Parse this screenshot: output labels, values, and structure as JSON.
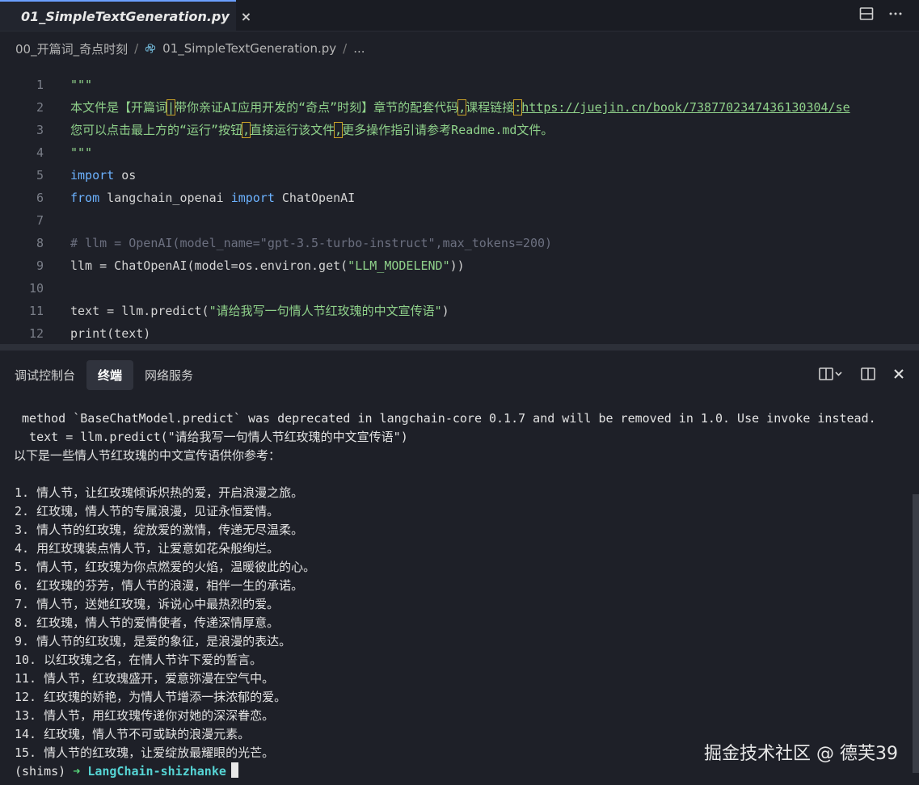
{
  "tab": {
    "label": "01_SimpleTextGeneration.py",
    "close": "×"
  },
  "breadcrumb": {
    "folder": "00_开篇词_奇点时刻",
    "file": "01_SimpleTextGeneration.py",
    "more": "..."
  },
  "editor": {
    "lines": [
      {
        "n": "1"
      },
      {
        "n": "2"
      },
      {
        "n": "3"
      },
      {
        "n": "4"
      },
      {
        "n": "5"
      },
      {
        "n": "6"
      },
      {
        "n": "7"
      },
      {
        "n": "8"
      },
      {
        "n": "9"
      },
      {
        "n": "10"
      },
      {
        "n": "11"
      },
      {
        "n": "12"
      }
    ],
    "code": {
      "l1": "\"\"\"",
      "l2a": "本文件是【开篇词",
      "l2b": "|",
      "l2c": "带你亲证AI应用开发的“奇点”时刻】章节的配套代码",
      "l2d": ",",
      "l2e": "课程链接",
      "l2f": ":",
      "l2g": "https://juejin.cn/book/7387702347436130304/se",
      "l3a": "您可以点击最上方的“运行”按钮",
      "l3b": ",",
      "l3c": "直接运行该文件",
      "l3d": ",",
      "l3e": "更多操作指引请参考Readme.md文件。",
      "l4": "\"\"\"",
      "l5kw": "import",
      "l5": " os",
      "l6kw1": "from",
      "l6mod": " langchain_openai ",
      "l6kw2": "import",
      "l6": " ChatOpenAI",
      "l8": "# llm = OpenAI(model_name=\"gpt-3.5-turbo-instruct\",max_tokens=200)",
      "l9a": "llm = ChatOpenAI(model=os.environ.get(",
      "l9s": "\"LLM_MODELEND\"",
      "l9b": "))",
      "l11a": "text = llm.predict(",
      "l11s": "\"请给我写一句情人节红玫瑰的中文宣传语\"",
      "l11b": ")",
      "l12": "print(text)"
    }
  },
  "panel": {
    "tabs": [
      "调试控制台",
      "终端",
      "网络服务"
    ],
    "active": "终端"
  },
  "terminal": {
    "lines": [
      " method `BaseChatModel.predict` was deprecated in langchain-core 0.1.7 and will be removed in 1.0. Use invoke instead.",
      "  text = llm.predict(\"请给我写一句情人节红玫瑰的中文宣传语\")",
      "以下是一些情人节红玫瑰的中文宣传语供你参考：",
      "",
      "1. 情人节，让红玫瑰倾诉炽热的爱，开启浪漫之旅。",
      "2. 红玫瑰，情人节的专属浪漫，见证永恒爱情。",
      "3. 情人节的红玫瑰，绽放爱的激情，传递无尽温柔。",
      "4. 用红玫瑰装点情人节，让爱意如花朵般绚烂。",
      "5. 情人节，红玫瑰为你点燃爱的火焰，温暖彼此的心。",
      "6. 红玫瑰的芬芳，情人节的浪漫，相伴一生的承诺。",
      "7. 情人节，送她红玫瑰，诉说心中最热烈的爱。",
      "8. 红玫瑰，情人节的爱情使者，传递深情厚意。",
      "9. 情人节的红玫瑰，是爱的象征，是浪漫的表达。",
      "10. 以红玫瑰之名，在情人节许下爱的誓言。",
      "11. 情人节，红玫瑰盛开，爱意弥漫在空气中。",
      "12. 红玫瑰的娇艳，为情人节增添一抹浓郁的爱。",
      "13. 情人节，用红玫瑰传递你对她的深深眷恋。",
      "14. 红玫瑰，情人节不可或缺的浪漫元素。",
      "15. 情人节的红玫瑰，让爱绽放最耀眼的光芒。"
    ],
    "prompt_env": "(shims)",
    "prompt_arrow": "➜",
    "prompt_dir": "LangChain-shizhanke"
  },
  "watermark": "掘金技术社区 @ 德芙39",
  "colors": {
    "accent": "#6b9fff",
    "string": "#8fd18a",
    "keyword": "#6cb2ff",
    "comment": "#6c7080"
  }
}
